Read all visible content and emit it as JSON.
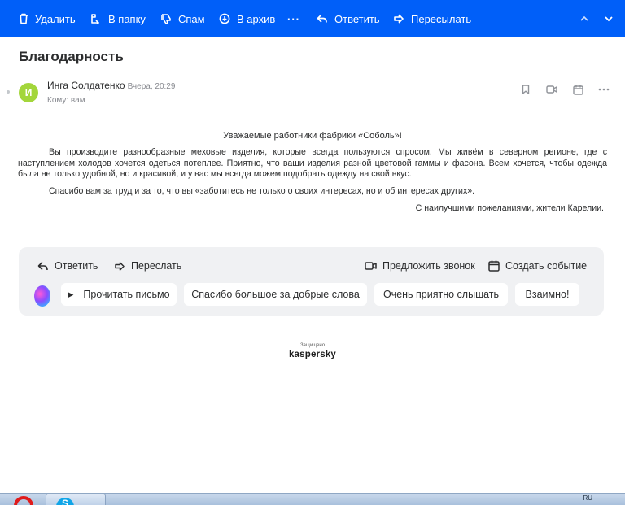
{
  "toolbar": {
    "delete": "Удалить",
    "to_folder": "В папку",
    "spam": "Спам",
    "archive": "В архив",
    "more": "···",
    "reply": "Ответить",
    "forward": "Пересылать"
  },
  "message": {
    "subject": "Благодарность",
    "avatar_letter": "И",
    "sender_name": "Инга Солдатенко",
    "date": "Вчера, 20:29",
    "recipient": "Кому: вам",
    "body": {
      "greeting": "Уважаемые работники фабрики «Соболь»!",
      "paragraph1": "Вы производите разнообразные меховые изделия, которые всегда пользуются спросом. Мы живём в северном регионе, где с наступлением холодов хочется одеться потеплее. Приятно, что ваши изделия разной цветовой гаммы и фасона. Всем хочется, чтобы одежда была не только удобной, но и красивой, и у вас мы всегда можем подобрать одежду на свой вкус.",
      "paragraph2": "Спасибо вам за труд и за то, что вы «заботитесь не только о своих интересах, но и об интересах других».",
      "signature": "С наилучшими пожеланиями, жители Карелии."
    }
  },
  "panel": {
    "reply": "Ответить",
    "forward": "Переслать",
    "call": "Предложить звонок",
    "event": "Создать событие",
    "chips": {
      "read": "Прочитать письмо",
      "thanks": "Спасибо большое за добрые слова",
      "nice": "Очень приятно слышать",
      "mutual": "Взаимно!"
    }
  },
  "footer": {
    "protected": "Защищено",
    "brand": "kaspersky"
  },
  "taskbar": {
    "lang": "RU"
  },
  "colors": {
    "toolbar_bg": "#005ff9",
    "avatar_bg": "#a3d63b",
    "panel_bg": "#f0f1f3"
  }
}
